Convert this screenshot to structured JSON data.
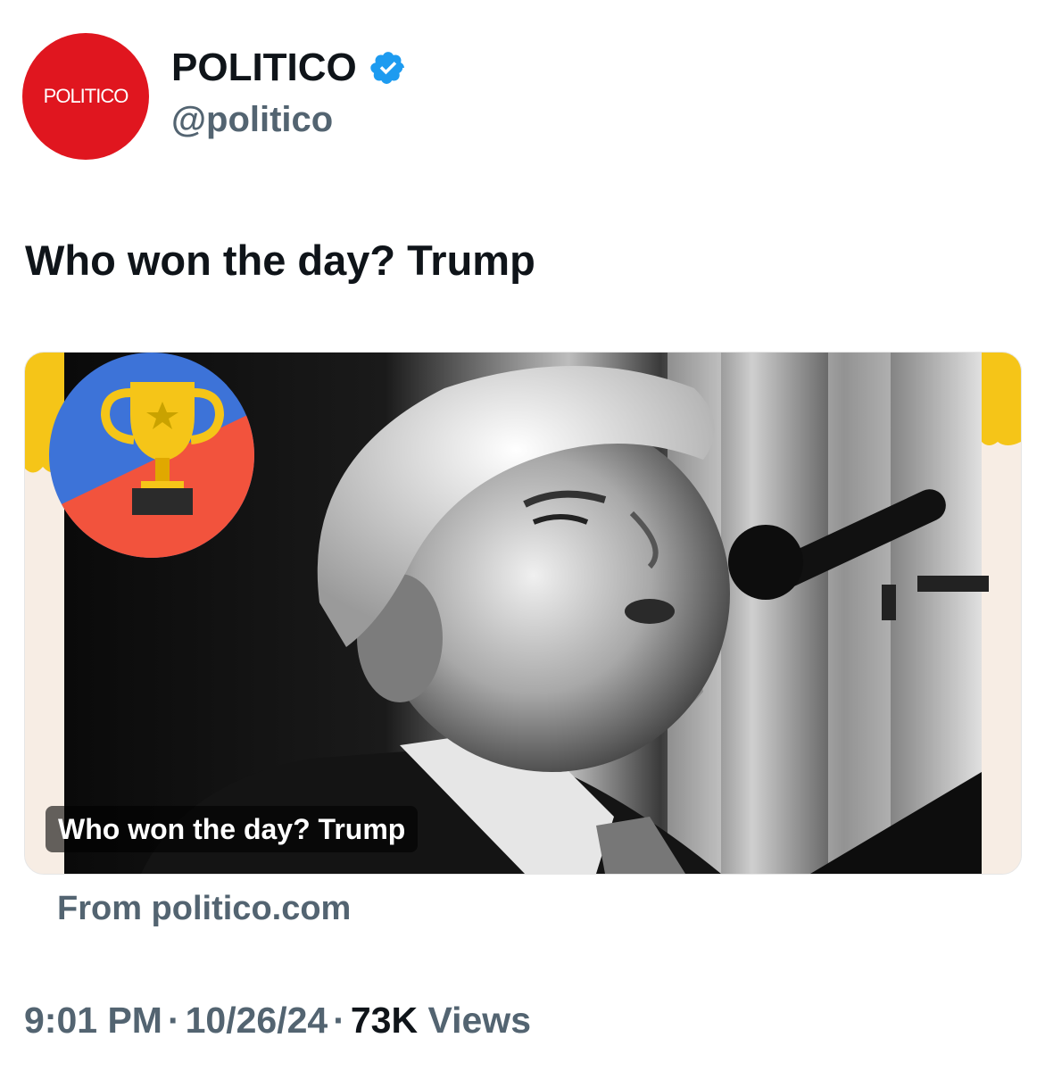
{
  "author": {
    "avatar_label": "POLITICO",
    "display_name": "POLITICO",
    "handle": "@politico",
    "verified": true,
    "avatar_color": "#e0161f",
    "verified_color": "#1d9bf0"
  },
  "tweet": {
    "text": "Who won the day? Trump"
  },
  "card": {
    "caption": "Who won the day? Trump",
    "source": "From politico.com",
    "image_icon": "trophy-icon"
  },
  "meta": {
    "time": "9:01 PM",
    "separator": "·",
    "date": "10/26/24",
    "views_count": "73K",
    "views_label": "Views"
  }
}
